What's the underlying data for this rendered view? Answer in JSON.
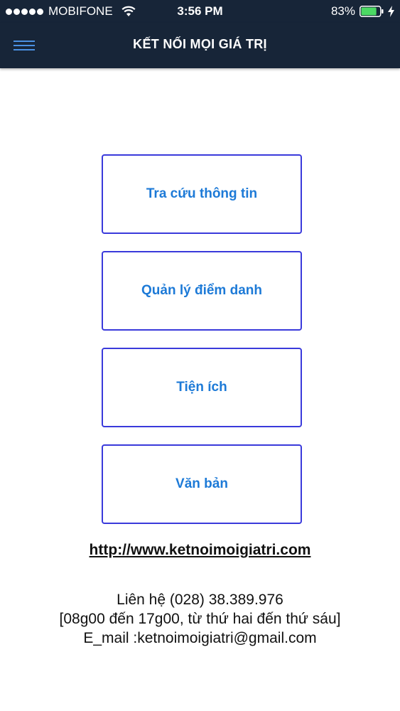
{
  "status_bar": {
    "carrier": "MOBIFONE",
    "time": "3:56 PM",
    "battery_percent": "83%",
    "battery_level": 0.83,
    "battery_color": "#4cd964"
  },
  "header": {
    "menu_icon": "hamburger-icon",
    "title": "KẾT NỐI MỌI GIÁ TRỊ",
    "background": "#172538",
    "menu_icon_color": "#4a90e2"
  },
  "menu": {
    "items": [
      {
        "label": "Tra cứu thông tin"
      },
      {
        "label": "Quản lý điểm danh"
      },
      {
        "label": "Tiện ích"
      },
      {
        "label": "Văn bản"
      }
    ],
    "border_color": "#3a3adb",
    "text_color": "#1d7ad7"
  },
  "footer": {
    "website": "http://www.ketnoimoigiatri.com",
    "contact_phone": "Liên hệ (028) 38.389.976",
    "contact_hours": "[08g00 đến 17g00, từ thứ hai đến thứ sáu]",
    "contact_email": "E_mail :ketnoimoigiatri@gmail.com"
  }
}
